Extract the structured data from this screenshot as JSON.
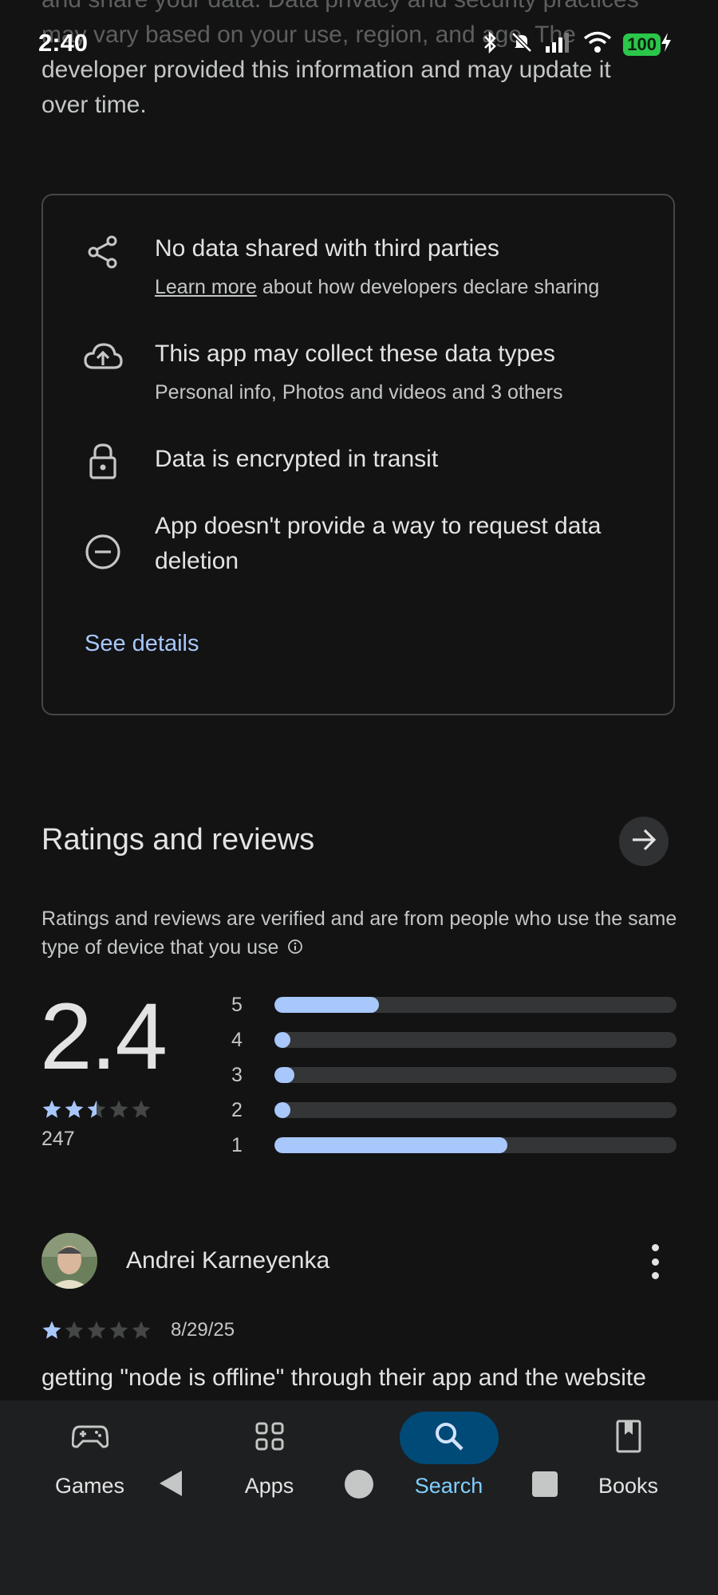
{
  "status_bar": {
    "time": "2:40",
    "battery": "100"
  },
  "intro": {
    "line_faded_1": "and share your data. Data privacy and security practices",
    "line_faded_2": "may vary based on your use, region, and age. The",
    "line_3": "developer provided this information and may update it",
    "line_4": "over time."
  },
  "data_safety": {
    "items": [
      {
        "icon": "share-icon",
        "title": "No data shared with third parties",
        "link": "Learn more",
        "subtitle": "about how developers declare sharing"
      },
      {
        "icon": "cloud-upload-icon",
        "title": "This app may collect these data types",
        "subtitle": "Personal info, Photos and videos and 3 others"
      },
      {
        "icon": "lock-icon",
        "title": "Data is encrypted in transit"
      },
      {
        "icon": "minus-circle-icon",
        "title": "App doesn't provide a way to request data deletion"
      }
    ],
    "see_details": "See details"
  },
  "ratings": {
    "heading": "Ratings and reviews",
    "note": "Ratings and reviews are verified and are from people who use the same type of device that you use",
    "score": "2.4",
    "score_stars": 2.5,
    "count": "247",
    "distribution": [
      {
        "label": "5",
        "fraction": 0.26
      },
      {
        "label": "4",
        "fraction": 0.04
      },
      {
        "label": "3",
        "fraction": 0.05
      },
      {
        "label": "2",
        "fraction": 0.04
      },
      {
        "label": "1",
        "fraction": 0.58
      }
    ],
    "colors": {
      "star_filled": "#a8c7fa",
      "star_empty": "#444746",
      "bar_fill": "#a8c7fa"
    }
  },
  "review": {
    "name": "Andrei Karneyenka",
    "stars": 1,
    "date": "8/29/25",
    "text": "getting \"node is offline\" through their app and the website"
  },
  "bottom_nav": {
    "items": [
      {
        "label": "Games",
        "icon": "gamepad-icon",
        "active": false
      },
      {
        "label": "Apps",
        "icon": "apps-grid-icon",
        "active": false
      },
      {
        "label": "Search",
        "icon": "search-icon",
        "active": true
      },
      {
        "label": "Books",
        "icon": "book-icon",
        "active": false
      }
    ]
  }
}
